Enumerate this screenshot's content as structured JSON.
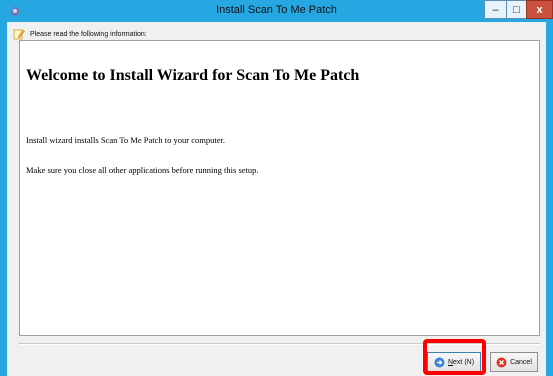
{
  "window": {
    "title": "Install Scan To Me Patch",
    "controls": {
      "minimize": "–",
      "maximize": "□",
      "close": "x"
    }
  },
  "header": {
    "text": "Please read the following information:"
  },
  "content": {
    "heading": "Welcome to Install Wizard for Scan To Me Patch",
    "paragraph1": "Install wizard installs Scan To Me Patch to your computer.",
    "paragraph2": "Make sure you close all other applications before running this setup."
  },
  "buttons": {
    "next_prefix": "N",
    "next_rest": "ext (N)",
    "cancel": "Cancel"
  },
  "colors": {
    "titlebar": "#27a7e2",
    "highlight": "#ff0000",
    "close_button": "#c7503f"
  }
}
